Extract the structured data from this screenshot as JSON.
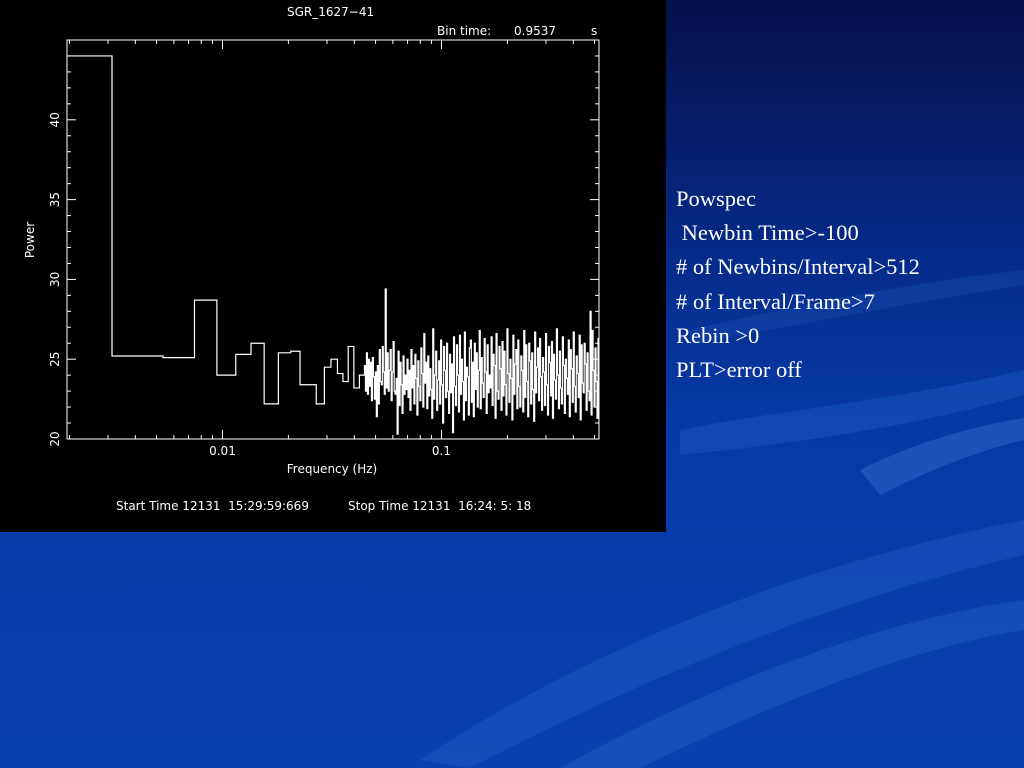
{
  "colors": {
    "plot_bg": "#000000",
    "plot_fg": "#ffffff",
    "slide_bg": "#0842b0"
  },
  "notes": {
    "lines": [
      "Powspec",
      " Newbin Time>-100",
      "# of Newbins/Interval>512",
      "# of Interval/Frame>7",
      "Rebin >0",
      "PLT>error off"
    ]
  },
  "chart_data": {
    "type": "line",
    "step": true,
    "title": "SGR_1627−41",
    "bin_time_label": "Bin time:",
    "bin_time_value": "0.9537",
    "bin_time_unit": "s",
    "xlabel": "Frequency (Hz)",
    "ylabel": "Power",
    "x_scale": "log",
    "xlim": [
      0.00195,
      0.524
    ],
    "ylim": [
      20,
      45
    ],
    "x_ticks": [
      {
        "value": 0.01,
        "label": "0.01"
      },
      {
        "value": 0.1,
        "label": "0.1"
      }
    ],
    "y_ticks": [
      {
        "value": 20,
        "label": "20"
      },
      {
        "value": 25,
        "label": "25"
      },
      {
        "value": 30,
        "label": "30"
      },
      {
        "value": 35,
        "label": "35"
      },
      {
        "value": 40,
        "label": "40"
      }
    ],
    "footer_start": "Start Time 12131  15:29:59:669",
    "footer_stop": "Stop Time 12131  16:24: 5: 18",
    "series": [
      {
        "low_bins": [
          [
            0.00195,
            0.00313,
            44.0
          ],
          [
            0.00313,
            0.00535,
            25.2
          ],
          [
            0.00535,
            0.00745,
            25.1
          ],
          [
            0.00745,
            0.00943,
            28.7
          ],
          [
            0.00943,
            0.0115,
            24.0
          ],
          [
            0.0115,
            0.0135,
            25.3
          ],
          [
            0.0135,
            0.0155,
            26.0
          ],
          [
            0.0155,
            0.018,
            22.2
          ],
          [
            0.018,
            0.0205,
            25.4
          ],
          [
            0.0205,
            0.0226,
            25.5
          ],
          [
            0.0226,
            0.0268,
            23.4
          ],
          [
            0.0268,
            0.0292,
            22.2
          ],
          [
            0.0292,
            0.0313,
            24.5
          ],
          [
            0.0313,
            0.0335,
            25.0
          ],
          [
            0.0335,
            0.0355,
            24.1
          ],
          [
            0.0355,
            0.0375,
            23.6
          ],
          [
            0.0375,
            0.0398,
            25.8
          ],
          [
            0.0398,
            0.0422,
            23.2
          ],
          [
            0.0422,
            0.0445,
            24.0
          ]
        ],
        "high_freq": [
          0.0445,
          0.524
        ],
        "high_values": [
          24.6,
          23.0,
          25.4,
          22.8,
          25.0,
          23.3,
          24.8,
          22.4,
          25.1,
          23.9,
          22.5,
          24.2,
          21.4,
          24.6,
          22.2,
          25.6,
          23.6,
          23.4,
          25.8,
          24.2,
          22.8,
          29.4,
          23.2,
          25.4,
          23.0,
          24.3,
          25.6,
          22.4,
          24.2,
          26.1,
          23.0,
          22.8,
          23.8,
          20.3,
          25.5,
          22.1,
          24.8,
          23.4,
          21.6,
          25.2,
          22.8,
          24.0,
          23.1,
          25.0,
          22.6,
          24.3,
          21.8,
          25.6,
          23.2,
          24.6,
          22.2,
          25.3,
          23.8,
          21.5,
          24.9,
          23.3,
          22.4,
          25.7,
          24.1,
          22.0,
          26.6,
          23.5,
          24.8,
          21.9,
          25.2,
          22.7,
          24.4,
          23.1,
          21.3,
          26.9,
          22.5,
          24.0,
          25.5,
          21.8,
          23.7,
          24.9,
          22.2,
          26.2,
          23.4,
          21.0,
          25.8,
          24.3,
          22.6,
          26.0,
          23.0,
          21.6,
          25.3,
          22.9,
          24.7,
          20.4,
          26.4,
          23.3,
          22.1,
          25.9,
          24.0,
          21.7,
          26.5,
          22.8,
          25.0,
          23.6,
          21.2,
          26.7,
          22.4,
          24.5,
          23.9,
          21.5,
          25.7,
          26.2,
          22.3,
          24.8,
          21.4,
          26.0,
          23.1,
          25.4,
          22.0,
          24.3,
          26.8,
          21.9,
          25.1,
          23.5,
          22.6,
          26.3,
          24.2,
          21.6,
          25.9,
          22.9,
          24.0,
          23.2,
          26.4,
          22.1,
          25.3,
          24.6,
          21.3,
          26.6,
          23.0,
          22.5,
          25.8,
          24.4,
          21.8,
          26.1,
          22.7,
          25.5,
          23.4,
          21.5,
          26.9,
          24.1,
          22.3,
          25.0,
          23.8,
          21.2,
          26.5,
          22.8,
          24.7,
          25.6,
          21.9,
          26.2,
          23.3,
          22.0,
          25.2,
          24.3,
          21.7,
          26.8,
          22.6,
          25.9,
          23.6,
          21.4,
          26.0,
          24.9,
          22.2,
          25.4,
          23.1,
          21.1,
          26.7,
          22.9,
          24.5,
          25.7,
          22.4,
          26.3,
          23.9,
          21.8,
          25.1,
          24.2,
          22.1,
          26.6,
          23.4,
          21.5,
          25.8,
          24.8,
          22.7,
          26.1,
          21.3,
          25.3,
          23.7,
          22.5,
          26.9,
          24.0,
          21.9,
          25.5,
          23.2,
          22.2,
          26.4,
          24.6,
          21.6,
          25.0,
          23.8,
          22.8,
          26.2,
          21.4,
          25.6,
          24.4,
          22.3,
          26.7,
          23.3,
          21.7,
          25.2,
          24.1,
          22.6,
          26.5,
          21.2,
          25.9,
          23.5,
          22.9,
          26.0,
          24.7,
          21.8,
          25.4,
          23.0,
          22.4,
          28.0,
          21.5,
          26.8,
          24.3,
          22.0,
          25.7,
          23.6,
          21.3,
          26.3
        ]
      }
    ]
  }
}
